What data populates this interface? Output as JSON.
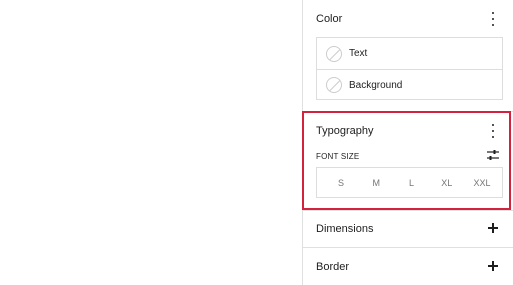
{
  "sidebar": {
    "color_panel": {
      "title": "Color",
      "items": [
        {
          "label": "Text",
          "icon": "swatch-empty-icon"
        },
        {
          "label": "Background",
          "icon": "swatch-empty-icon"
        }
      ]
    },
    "typography_panel": {
      "title": "Typography",
      "font_size_label": "FONT SIZE",
      "sizes": [
        "S",
        "M",
        "L",
        "XL",
        "XXL"
      ]
    },
    "dimensions_panel": {
      "title": "Dimensions"
    },
    "border_panel": {
      "title": "Border"
    }
  },
  "colors": {
    "highlight": "#d4213d",
    "border": "#dddddd"
  }
}
